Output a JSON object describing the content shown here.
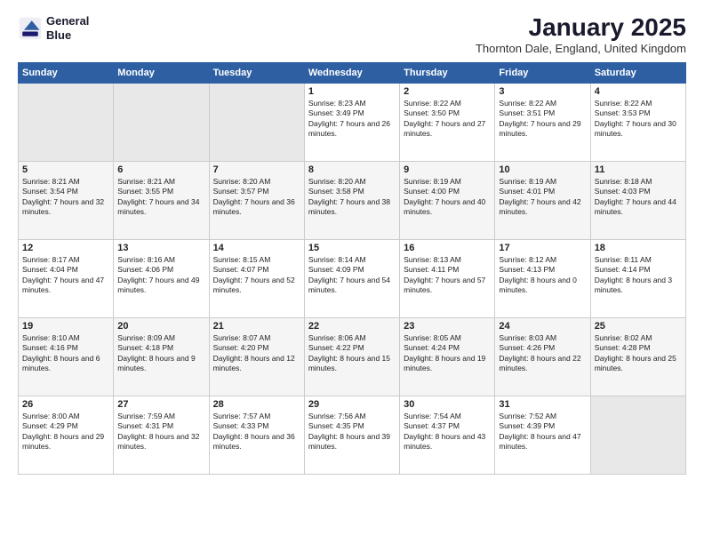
{
  "header": {
    "logo_line1": "General",
    "logo_line2": "Blue",
    "month": "January 2025",
    "location": "Thornton Dale, England, United Kingdom"
  },
  "days_of_week": [
    "Sunday",
    "Monday",
    "Tuesday",
    "Wednesday",
    "Thursday",
    "Friday",
    "Saturday"
  ],
  "weeks": [
    [
      {
        "day": "",
        "sunrise": "",
        "sunset": "",
        "daylight": ""
      },
      {
        "day": "",
        "sunrise": "",
        "sunset": "",
        "daylight": ""
      },
      {
        "day": "",
        "sunrise": "",
        "sunset": "",
        "daylight": ""
      },
      {
        "day": "1",
        "sunrise": "Sunrise: 8:23 AM",
        "sunset": "Sunset: 3:49 PM",
        "daylight": "Daylight: 7 hours and 26 minutes."
      },
      {
        "day": "2",
        "sunrise": "Sunrise: 8:22 AM",
        "sunset": "Sunset: 3:50 PM",
        "daylight": "Daylight: 7 hours and 27 minutes."
      },
      {
        "day": "3",
        "sunrise": "Sunrise: 8:22 AM",
        "sunset": "Sunset: 3:51 PM",
        "daylight": "Daylight: 7 hours and 29 minutes."
      },
      {
        "day": "4",
        "sunrise": "Sunrise: 8:22 AM",
        "sunset": "Sunset: 3:53 PM",
        "daylight": "Daylight: 7 hours and 30 minutes."
      }
    ],
    [
      {
        "day": "5",
        "sunrise": "Sunrise: 8:21 AM",
        "sunset": "Sunset: 3:54 PM",
        "daylight": "Daylight: 7 hours and 32 minutes."
      },
      {
        "day": "6",
        "sunrise": "Sunrise: 8:21 AM",
        "sunset": "Sunset: 3:55 PM",
        "daylight": "Daylight: 7 hours and 34 minutes."
      },
      {
        "day": "7",
        "sunrise": "Sunrise: 8:20 AM",
        "sunset": "Sunset: 3:57 PM",
        "daylight": "Daylight: 7 hours and 36 minutes."
      },
      {
        "day": "8",
        "sunrise": "Sunrise: 8:20 AM",
        "sunset": "Sunset: 3:58 PM",
        "daylight": "Daylight: 7 hours and 38 minutes."
      },
      {
        "day": "9",
        "sunrise": "Sunrise: 8:19 AM",
        "sunset": "Sunset: 4:00 PM",
        "daylight": "Daylight: 7 hours and 40 minutes."
      },
      {
        "day": "10",
        "sunrise": "Sunrise: 8:19 AM",
        "sunset": "Sunset: 4:01 PM",
        "daylight": "Daylight: 7 hours and 42 minutes."
      },
      {
        "day": "11",
        "sunrise": "Sunrise: 8:18 AM",
        "sunset": "Sunset: 4:03 PM",
        "daylight": "Daylight: 7 hours and 44 minutes."
      }
    ],
    [
      {
        "day": "12",
        "sunrise": "Sunrise: 8:17 AM",
        "sunset": "Sunset: 4:04 PM",
        "daylight": "Daylight: 7 hours and 47 minutes."
      },
      {
        "day": "13",
        "sunrise": "Sunrise: 8:16 AM",
        "sunset": "Sunset: 4:06 PM",
        "daylight": "Daylight: 7 hours and 49 minutes."
      },
      {
        "day": "14",
        "sunrise": "Sunrise: 8:15 AM",
        "sunset": "Sunset: 4:07 PM",
        "daylight": "Daylight: 7 hours and 52 minutes."
      },
      {
        "day": "15",
        "sunrise": "Sunrise: 8:14 AM",
        "sunset": "Sunset: 4:09 PM",
        "daylight": "Daylight: 7 hours and 54 minutes."
      },
      {
        "day": "16",
        "sunrise": "Sunrise: 8:13 AM",
        "sunset": "Sunset: 4:11 PM",
        "daylight": "Daylight: 7 hours and 57 minutes."
      },
      {
        "day": "17",
        "sunrise": "Sunrise: 8:12 AM",
        "sunset": "Sunset: 4:13 PM",
        "daylight": "Daylight: 8 hours and 0 minutes."
      },
      {
        "day": "18",
        "sunrise": "Sunrise: 8:11 AM",
        "sunset": "Sunset: 4:14 PM",
        "daylight": "Daylight: 8 hours and 3 minutes."
      }
    ],
    [
      {
        "day": "19",
        "sunrise": "Sunrise: 8:10 AM",
        "sunset": "Sunset: 4:16 PM",
        "daylight": "Daylight: 8 hours and 6 minutes."
      },
      {
        "day": "20",
        "sunrise": "Sunrise: 8:09 AM",
        "sunset": "Sunset: 4:18 PM",
        "daylight": "Daylight: 8 hours and 9 minutes."
      },
      {
        "day": "21",
        "sunrise": "Sunrise: 8:07 AM",
        "sunset": "Sunset: 4:20 PM",
        "daylight": "Daylight: 8 hours and 12 minutes."
      },
      {
        "day": "22",
        "sunrise": "Sunrise: 8:06 AM",
        "sunset": "Sunset: 4:22 PM",
        "daylight": "Daylight: 8 hours and 15 minutes."
      },
      {
        "day": "23",
        "sunrise": "Sunrise: 8:05 AM",
        "sunset": "Sunset: 4:24 PM",
        "daylight": "Daylight: 8 hours and 19 minutes."
      },
      {
        "day": "24",
        "sunrise": "Sunrise: 8:03 AM",
        "sunset": "Sunset: 4:26 PM",
        "daylight": "Daylight: 8 hours and 22 minutes."
      },
      {
        "day": "25",
        "sunrise": "Sunrise: 8:02 AM",
        "sunset": "Sunset: 4:28 PM",
        "daylight": "Daylight: 8 hours and 25 minutes."
      }
    ],
    [
      {
        "day": "26",
        "sunrise": "Sunrise: 8:00 AM",
        "sunset": "Sunset: 4:29 PM",
        "daylight": "Daylight: 8 hours and 29 minutes."
      },
      {
        "day": "27",
        "sunrise": "Sunrise: 7:59 AM",
        "sunset": "Sunset: 4:31 PM",
        "daylight": "Daylight: 8 hours and 32 minutes."
      },
      {
        "day": "28",
        "sunrise": "Sunrise: 7:57 AM",
        "sunset": "Sunset: 4:33 PM",
        "daylight": "Daylight: 8 hours and 36 minutes."
      },
      {
        "day": "29",
        "sunrise": "Sunrise: 7:56 AM",
        "sunset": "Sunset: 4:35 PM",
        "daylight": "Daylight: 8 hours and 39 minutes."
      },
      {
        "day": "30",
        "sunrise": "Sunrise: 7:54 AM",
        "sunset": "Sunset: 4:37 PM",
        "daylight": "Daylight: 8 hours and 43 minutes."
      },
      {
        "day": "31",
        "sunrise": "Sunrise: 7:52 AM",
        "sunset": "Sunset: 4:39 PM",
        "daylight": "Daylight: 8 hours and 47 minutes."
      },
      {
        "day": "",
        "sunrise": "",
        "sunset": "",
        "daylight": ""
      }
    ]
  ]
}
